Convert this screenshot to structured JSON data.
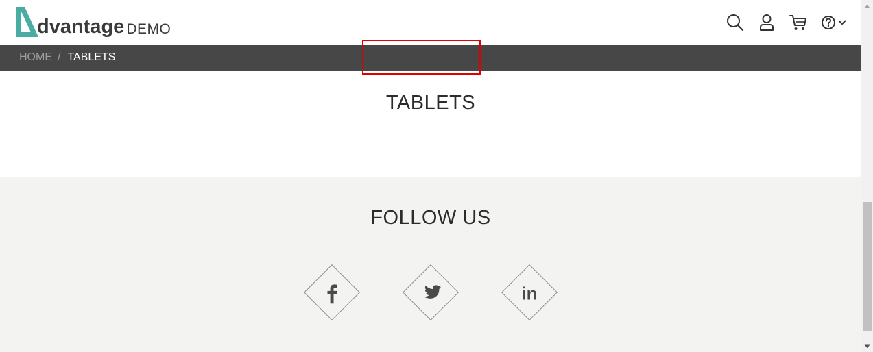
{
  "header": {
    "logo": {
      "word": "dvantage",
      "suffix": "DEMO",
      "mark_color": "#4aada4"
    },
    "icons": [
      "search-icon",
      "user-icon",
      "cart-icon",
      "help-icon",
      "chevron-down-icon"
    ]
  },
  "breadcrumb": {
    "home": "HOME",
    "separator": "/",
    "current": "TABLETS"
  },
  "main": {
    "title": "TABLETS"
  },
  "footer": {
    "heading": "FOLLOW US",
    "social": [
      {
        "name": "facebook",
        "glyph": "f"
      },
      {
        "name": "twitter",
        "glyph": ""
      },
      {
        "name": "linkedin",
        "glyph": "in"
      }
    ]
  },
  "colors": {
    "breadcrumb_bar": "#474747",
    "footer_bg": "#f3f3f1",
    "highlight_box": "#e00000",
    "brand_teal": "#4aada4"
  }
}
